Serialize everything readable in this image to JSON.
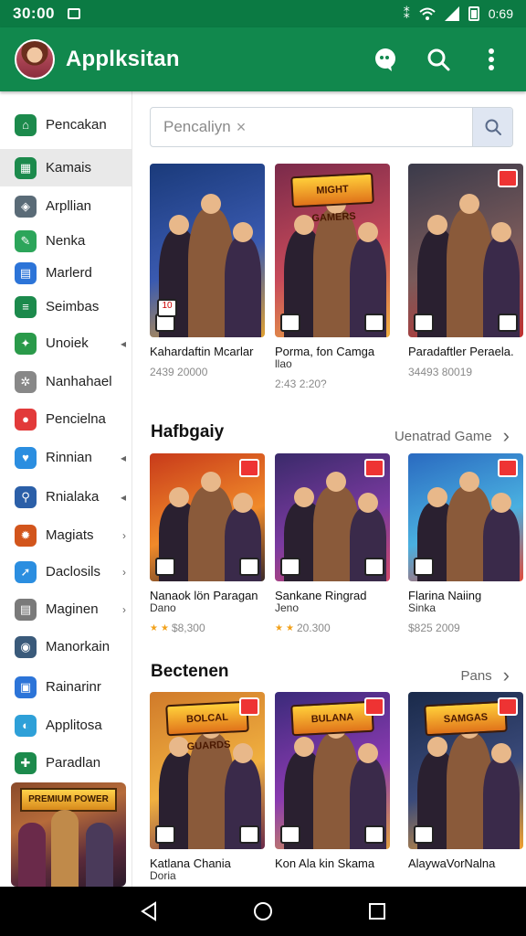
{
  "status": {
    "time": "30:00",
    "right_text": "0:69",
    "icons": [
      "notification-icon",
      "vibrate-icon",
      "wifi-icon",
      "signal-icon",
      "battery-icon"
    ]
  },
  "appbar": {
    "title": "Applksitan",
    "icons": [
      "chat-icon",
      "search-icon",
      "more-icon"
    ]
  },
  "colors": {
    "primary": "#11884d",
    "status": "#0b7a43",
    "star": "#f2a21c"
  },
  "sidebar": {
    "items": [
      {
        "label": "Pencakan",
        "icon": "home-icon",
        "color": "#1c8a4c",
        "active": false
      },
      {
        "label": "Kamais",
        "icon": "grid-icon",
        "color": "#1c8a4c",
        "active": true
      },
      {
        "label": "Arpllian",
        "icon": "shield-icon",
        "color": "#5a6b77",
        "active": false
      },
      {
        "label": "Nenka",
        "icon": "tag-icon",
        "color": "#2ca55a",
        "active": false
      },
      {
        "label": "Marlerd",
        "icon": "store-icon",
        "color": "#2c74d8",
        "active": false
      },
      {
        "label": "Seimbas",
        "icon": "list-icon",
        "color": "#1c8a4c",
        "active": false
      },
      {
        "label": "Unoiek",
        "icon": "key-icon",
        "color": "#2a9a4a",
        "active": false,
        "chevron": "◂"
      },
      {
        "label": "Nanhahael",
        "icon": "settings-icon",
        "color": "#888888",
        "active": false
      },
      {
        "label": "Pencielna",
        "icon": "record-icon",
        "color": "#e23a3a",
        "active": false
      },
      {
        "label": "Rinnian",
        "icon": "heart-icon",
        "color": "#2b8ee0",
        "active": false,
        "chevron": "◂"
      },
      {
        "label": "Rnialaka",
        "icon": "gamepad-icon",
        "color": "#2b5fa8",
        "active": false,
        "chevron": "◂"
      },
      {
        "label": "Magiats",
        "icon": "fire-icon",
        "color": "#d2551c",
        "active": false,
        "chevron": "›"
      },
      {
        "label": "Daclosils",
        "icon": "compass-icon",
        "color": "#2b8ee0",
        "active": false,
        "chevron": "›"
      },
      {
        "label": "Maginen",
        "icon": "document-icon",
        "color": "#7a7a7a",
        "active": false,
        "chevron": "›"
      },
      {
        "label": "Manorkain",
        "icon": "portrait-icon",
        "color": "#3a5a7a",
        "active": false
      },
      {
        "label": "Rainarinr",
        "icon": "badge-icon",
        "color": "#2c74d8",
        "active": false
      },
      {
        "label": "Applitosa",
        "icon": "planet-icon",
        "color": "#2ea0d8",
        "active": false
      },
      {
        "label": "Paradlan",
        "icon": "puzzle-icon",
        "color": "#1c8a4c",
        "active": false
      }
    ]
  },
  "search": {
    "placeholder": "Pencaliyn",
    "clear": "×"
  },
  "sections": [
    {
      "title": "",
      "link": "",
      "cards": [
        {
          "name": "Kahardaftin Mcarlar",
          "sub": "",
          "meta": "2439 20000",
          "stars": 0
        },
        {
          "name": "Porma, fon Camga",
          "sub": "llao",
          "meta": "2:43 2:20?",
          "stars": 0
        },
        {
          "name": "Paradaftler Peraela.",
          "sub": "",
          "meta": "34493 80019",
          "stars": 0
        }
      ]
    },
    {
      "title": "Hafbgaiy",
      "link": "Uenatrad Game",
      "cards": [
        {
          "name": "Nanaok lön Paragan",
          "sub": "Dano",
          "meta": "$8,300",
          "stars": 2
        },
        {
          "name": "Sankane Ringrad",
          "sub": "Jeno",
          "meta": "20.300",
          "stars": 2
        },
        {
          "name": "Flarina Naiing",
          "sub": "Sinka",
          "meta": "$825 2009",
          "stars": 0
        }
      ]
    },
    {
      "title": "Bectenen",
      "link": "Pans",
      "cards": [
        {
          "name": "Katlana Chania",
          "sub": "Doria",
          "meta": "",
          "stars": 0
        },
        {
          "name": "Kon Ala kin Skama",
          "sub": "",
          "meta": "",
          "stars": 0
        },
        {
          "name": "AlaywaVorNalna",
          "sub": "",
          "meta": "",
          "stars": 0
        }
      ]
    }
  ],
  "art": {
    "card_logos": [
      "",
      "MIGHT GAMERS",
      "",
      "",
      "",
      "",
      "BOLCAL GUARDS",
      "BULANA",
      "SAMGAS"
    ],
    "corner_badges": [
      "10",
      "",
      "",
      "",
      "",
      "",
      "",
      "",
      ""
    ],
    "sidebar_banner": "PREMIUM POWER"
  },
  "navbar": {
    "buttons": [
      "back-icon",
      "home-icon",
      "recents-icon"
    ]
  }
}
